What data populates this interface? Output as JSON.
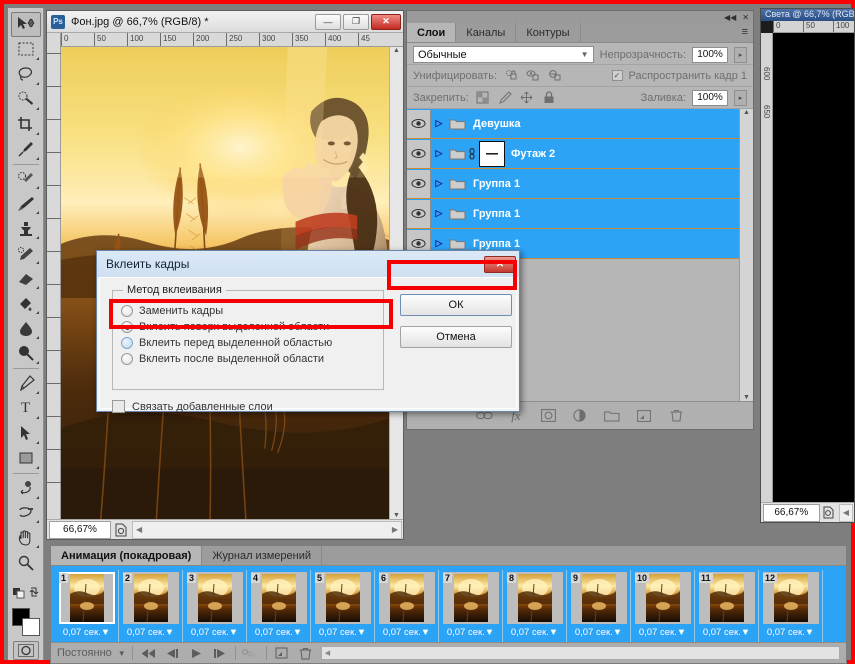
{
  "document_window": {
    "title": "Фон.jpg @ 66,7% (RGB/8) *",
    "logo": "Ps",
    "minimize": "—",
    "maximize": "❐",
    "close": "✕",
    "zoom_level": "66,67%",
    "ruler_ticks": [
      "0",
      "50",
      "100",
      "150",
      "200",
      "250",
      "300",
      "350",
      "400",
      "45"
    ]
  },
  "back_document_window": {
    "title": "Света @ 66,7% (RGB...",
    "zoom_level": "66,67%",
    "ruler_ticks": [
      "0",
      "50",
      "100"
    ],
    "vertical_ticks": [
      "600",
      "650"
    ]
  },
  "toolbar": {
    "tools": [
      {
        "name": "move-tool",
        "selected": true
      },
      {
        "name": "rectangular-marquee-tool",
        "selected": false
      },
      {
        "name": "lasso-tool",
        "selected": false
      },
      {
        "name": "quick-selection-tool",
        "selected": false
      },
      {
        "name": "crop-tool",
        "selected": false
      },
      {
        "name": "eyedropper-tool",
        "selected": false
      },
      {
        "name": "spot-healing-brush-tool",
        "selected": false
      },
      {
        "name": "brush-tool",
        "selected": false
      },
      {
        "name": "clone-stamp-tool",
        "selected": false
      },
      {
        "name": "history-brush-tool",
        "selected": false
      },
      {
        "name": "eraser-tool",
        "selected": false
      },
      {
        "name": "gradient-tool",
        "selected": false
      },
      {
        "name": "blur-tool",
        "selected": false
      },
      {
        "name": "dodge-tool",
        "selected": false
      },
      {
        "name": "pen-tool",
        "selected": false
      },
      {
        "name": "type-tool",
        "selected": false
      },
      {
        "name": "path-selection-tool",
        "selected": false
      },
      {
        "name": "rectangle-tool",
        "selected": false
      },
      {
        "name": "3d-rotate-tool",
        "selected": false
      },
      {
        "name": "3d-orbit-tool",
        "selected": false
      },
      {
        "name": "hand-tool",
        "selected": false
      },
      {
        "name": "zoom-tool",
        "selected": false
      }
    ],
    "type_tool_glyph": "T",
    "foreground_color": "#000000",
    "background_color": "#ffffff"
  },
  "layers_panel": {
    "collapse_icon": "◀◀",
    "close_icon": "✕",
    "menu_icon": "≡",
    "tabs": [
      {
        "label": "Слои",
        "active": true
      },
      {
        "label": "Каналы",
        "active": false
      },
      {
        "label": "Контуры",
        "active": false
      }
    ],
    "blend_mode": "Обычные",
    "opacity_label": "Непрозрачность:",
    "opacity_value": "100%",
    "unify_label": "Унифицировать:",
    "propagate_label": "Распространить кадр 1",
    "propagate_checked": true,
    "lock_label": "Закрепить:",
    "fill_label": "Заливка:",
    "fill_value": "100%",
    "layers": [
      {
        "name": "Девушка",
        "type": "group",
        "selected": true,
        "visible": true,
        "has_mask": false
      },
      {
        "name": "Футаж 2",
        "type": "group",
        "selected": true,
        "visible": true,
        "has_mask": true
      },
      {
        "name": "Группа 1",
        "type": "group",
        "selected": true,
        "visible": true,
        "has_mask": false
      },
      {
        "name": "Группа 1",
        "type": "group",
        "selected": true,
        "visible": true,
        "has_mask": false
      },
      {
        "name": "Группа 1",
        "type": "group",
        "selected": true,
        "visible": true,
        "has_mask": false
      }
    ],
    "footer_icons": [
      "link-layers-icon",
      "layer-style-icon",
      "layer-mask-icon",
      "adjustment-layer-icon",
      "new-group-icon",
      "new-layer-icon",
      "delete-layer-icon"
    ],
    "selection_color": "#2da3f5"
  },
  "animation_panel": {
    "tabs": [
      {
        "label": "Анимация (покадровая)",
        "active": true
      },
      {
        "label": "Журнал измерений",
        "active": false
      }
    ],
    "frames": [
      {
        "number": "1",
        "delay": "0,07 сек.",
        "selected": true
      },
      {
        "number": "2",
        "delay": "0,07 сек.",
        "selected": false
      },
      {
        "number": "3",
        "delay": "0,07 сек.",
        "selected": false
      },
      {
        "number": "4",
        "delay": "0,07 сек.",
        "selected": false
      },
      {
        "number": "5",
        "delay": "0,07 сек.",
        "selected": false
      },
      {
        "number": "6",
        "delay": "0,07 сек.",
        "selected": false
      },
      {
        "number": "7",
        "delay": "0,07 сек.",
        "selected": false
      },
      {
        "number": "8",
        "delay": "0,07 сек.",
        "selected": false
      },
      {
        "number": "9",
        "delay": "0,07 сек.",
        "selected": false
      },
      {
        "number": "10",
        "delay": "0,07 сек.",
        "selected": false
      },
      {
        "number": "11",
        "delay": "0,07 сек.",
        "selected": false
      },
      {
        "number": "12",
        "delay": "0,07 сек.",
        "selected": false
      }
    ],
    "loop_option": "Постоянно",
    "controls": [
      "select-first-frame-icon",
      "select-previous-frame-icon",
      "play-animation-icon",
      "select-next-frame-icon",
      "tween-icon",
      "duplicate-frame-icon",
      "delete-frame-icon"
    ]
  },
  "paste_dialog": {
    "title": "Вклеить кадры",
    "close_label": "✕",
    "group_legend": "Метод вклеивания",
    "options": [
      {
        "label": "Заменить кадры",
        "selected": false,
        "style": "plain"
      },
      {
        "label": "Вклеить поверх выделенной области",
        "selected": true,
        "style": "plain"
      },
      {
        "label": "Вклеить перед выделенной областью",
        "selected": false,
        "style": "blue"
      },
      {
        "label": "Вклеить после выделенной области",
        "selected": false,
        "style": "plain"
      }
    ],
    "checkbox_label": "Связать добавленные слои",
    "checkbox_checked": false,
    "ok_label": "ОК",
    "cancel_label": "Отмена"
  },
  "annotations": {
    "highlight_color": "#f40000",
    "boxes": [
      {
        "name": "highlight-selected-radio"
      },
      {
        "name": "highlight-ok-button"
      },
      {
        "name": "highlight-screen-border"
      }
    ]
  }
}
